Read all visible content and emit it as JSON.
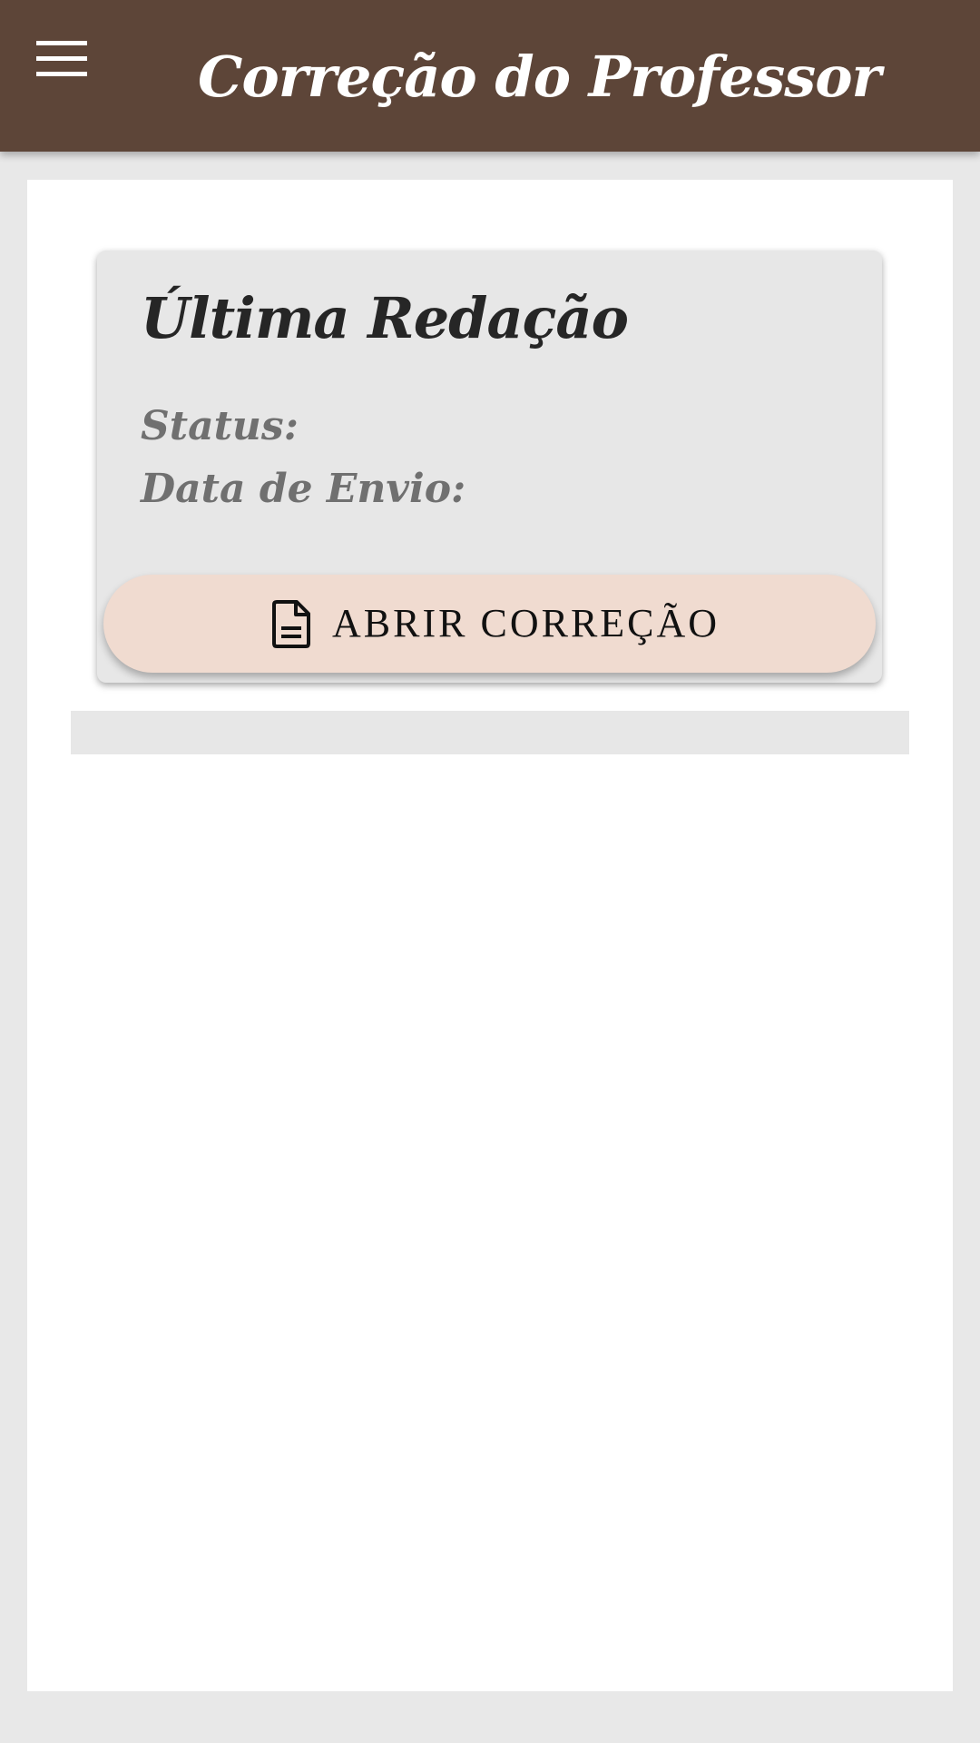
{
  "app_bar": {
    "title": "Correção do Professor",
    "menu_icon": "hamburger-menu-icon",
    "background_color": "#5d4538"
  },
  "essay_card": {
    "title": "Última Redação",
    "status_label": "Status:",
    "status_value": "",
    "date_label": "Data de Envio:",
    "date_value": "",
    "open_button": {
      "label": "ABRIR CORREÇÃO",
      "icon": "document-icon",
      "background_color": "#f0dbd0"
    }
  }
}
